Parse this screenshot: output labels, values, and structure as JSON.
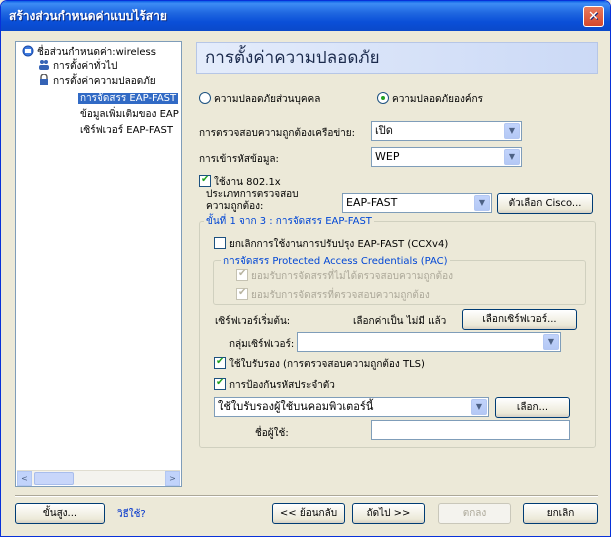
{
  "window": {
    "title": "สร้างส่วนกำหนดค่าแบบไร้สาย",
    "close_glyph": "✕"
  },
  "tree": {
    "items": [
      {
        "label": "ชื่อส่วนกำหนดค่า:wireless",
        "icon": "network-profile-icon"
      },
      {
        "label": "การตั้งค่าทั่วไป",
        "icon": "users-icon"
      },
      {
        "label": "การตั้งค่าความปลอดภัย",
        "icon": "lock-icon"
      },
      {
        "label": "การจัดสรร EAP-FAST"
      },
      {
        "label": "ข้อมูลเพิ่มเติมของ EAP"
      },
      {
        "label": "เซิร์ฟเวอร์ EAP-FAST"
      }
    ],
    "scroll_left": "<",
    "scroll_right": ">"
  },
  "panel": {
    "title": "การตั้งค่าความปลอดภัย"
  },
  "security_mode": {
    "personal": "ความปลอดภัยส่วนบุคคล",
    "enterprise": "ความปลอดภัยองค์กร",
    "selected": "enterprise"
  },
  "network_auth": {
    "label": "การตรวจสอบความถูกต้องเครือข่าย:",
    "value": "เปิด"
  },
  "data_encryption": {
    "label": "การเข้ารหัสข้อมูล:",
    "value": "WEP"
  },
  "enable_8021x": {
    "label": "ใช้งาน 802.1x",
    "checked": true
  },
  "auth_type": {
    "label_line1": "ประเภทการตรวจสอบ",
    "label_line2": "ความถูกต้อง:",
    "value": "EAP-FAST",
    "cisco_button": "ตัวเลือก Cisco..."
  },
  "step_group": {
    "title": "ขั้นที่ 1 จาก 3 : การจัดสรร EAP-FAST",
    "disable_ccx": {
      "label": "ยกเลิกการใช้งานการปรับปรุง EAP-FAST (CCXv4)",
      "checked": false
    },
    "pac_group": {
      "title": "การจัดสรร Protected Access Credentials (PAC)",
      "unauthenticated": {
        "label": "ยอมรับการจัดสรรที่ไม่ได้ตรวจสอบความถูกต้อง",
        "checked": true
      },
      "authenticated": {
        "label": "ยอมรับการจัดสรรที่ตรวจสอบความถูกต้อง",
        "checked": true
      }
    },
    "start_server": {
      "label": "เซิร์ฟเวอร์เริ่มต้น:",
      "value": "เลือกค่าเป็น ไม่มี แล้ว",
      "button": "เลือกเซิร์ฟเวอร์..."
    },
    "server_group": {
      "label": "กลุ่มเซิร์ฟเวอร์:",
      "value": ""
    },
    "use_certificate": {
      "label": "ใช้ใบรับรอง (การตรวจสอบความถูกต้อง TLS)",
      "checked": true
    },
    "protect_password": {
      "label": "การป้องกันรหัสประจำตัว",
      "checked": true
    },
    "cert_select": {
      "value": "ใช้ใบรับรองผู้ใช้บนคอมพิวเตอร์นี้",
      "button": "เลือก..."
    },
    "username": {
      "label": "ชื่อผู้ใช้:",
      "value": ""
    }
  },
  "footer": {
    "advanced": "ขั้นสูง...",
    "help": "วิธีใช้?",
    "back": "<< ย้อนกลับ",
    "next": "ถัดไป >>",
    "ok": "ตกลง",
    "cancel": "ยกเลิก"
  }
}
